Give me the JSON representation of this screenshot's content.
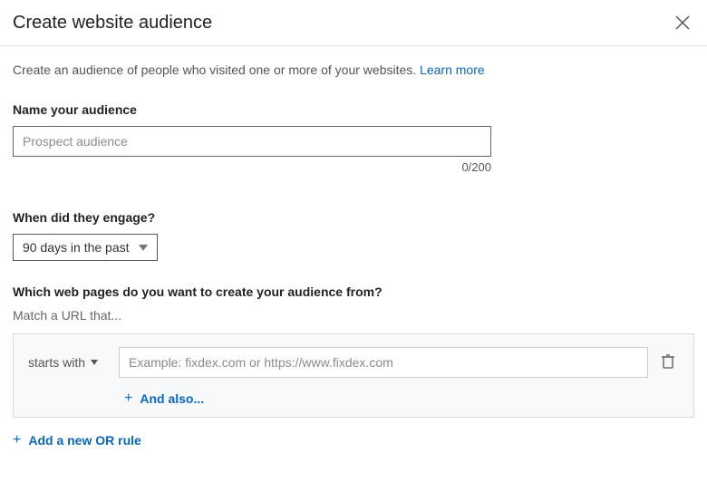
{
  "header": {
    "title": "Create website audience"
  },
  "description": {
    "text": "Create an audience of people who visited one or more of your websites. ",
    "link_text": "Learn more"
  },
  "nameSection": {
    "label": "Name your audience",
    "placeholder": "Prospect audience",
    "value": "",
    "counter": "0/200"
  },
  "engageSection": {
    "label": "When did they engage?",
    "selected": "90 days in the past"
  },
  "pagesSection": {
    "label": "Which web pages do you want to create your audience from?",
    "matchLabel": "Match a URL that...",
    "rule": {
      "operator": "starts with",
      "url_placeholder": "Example: fixdex.com or https://www.fixdex.com",
      "url_value": ""
    },
    "andAlsoLabel": "And also...",
    "orRuleLabel": "Add a new OR rule"
  }
}
